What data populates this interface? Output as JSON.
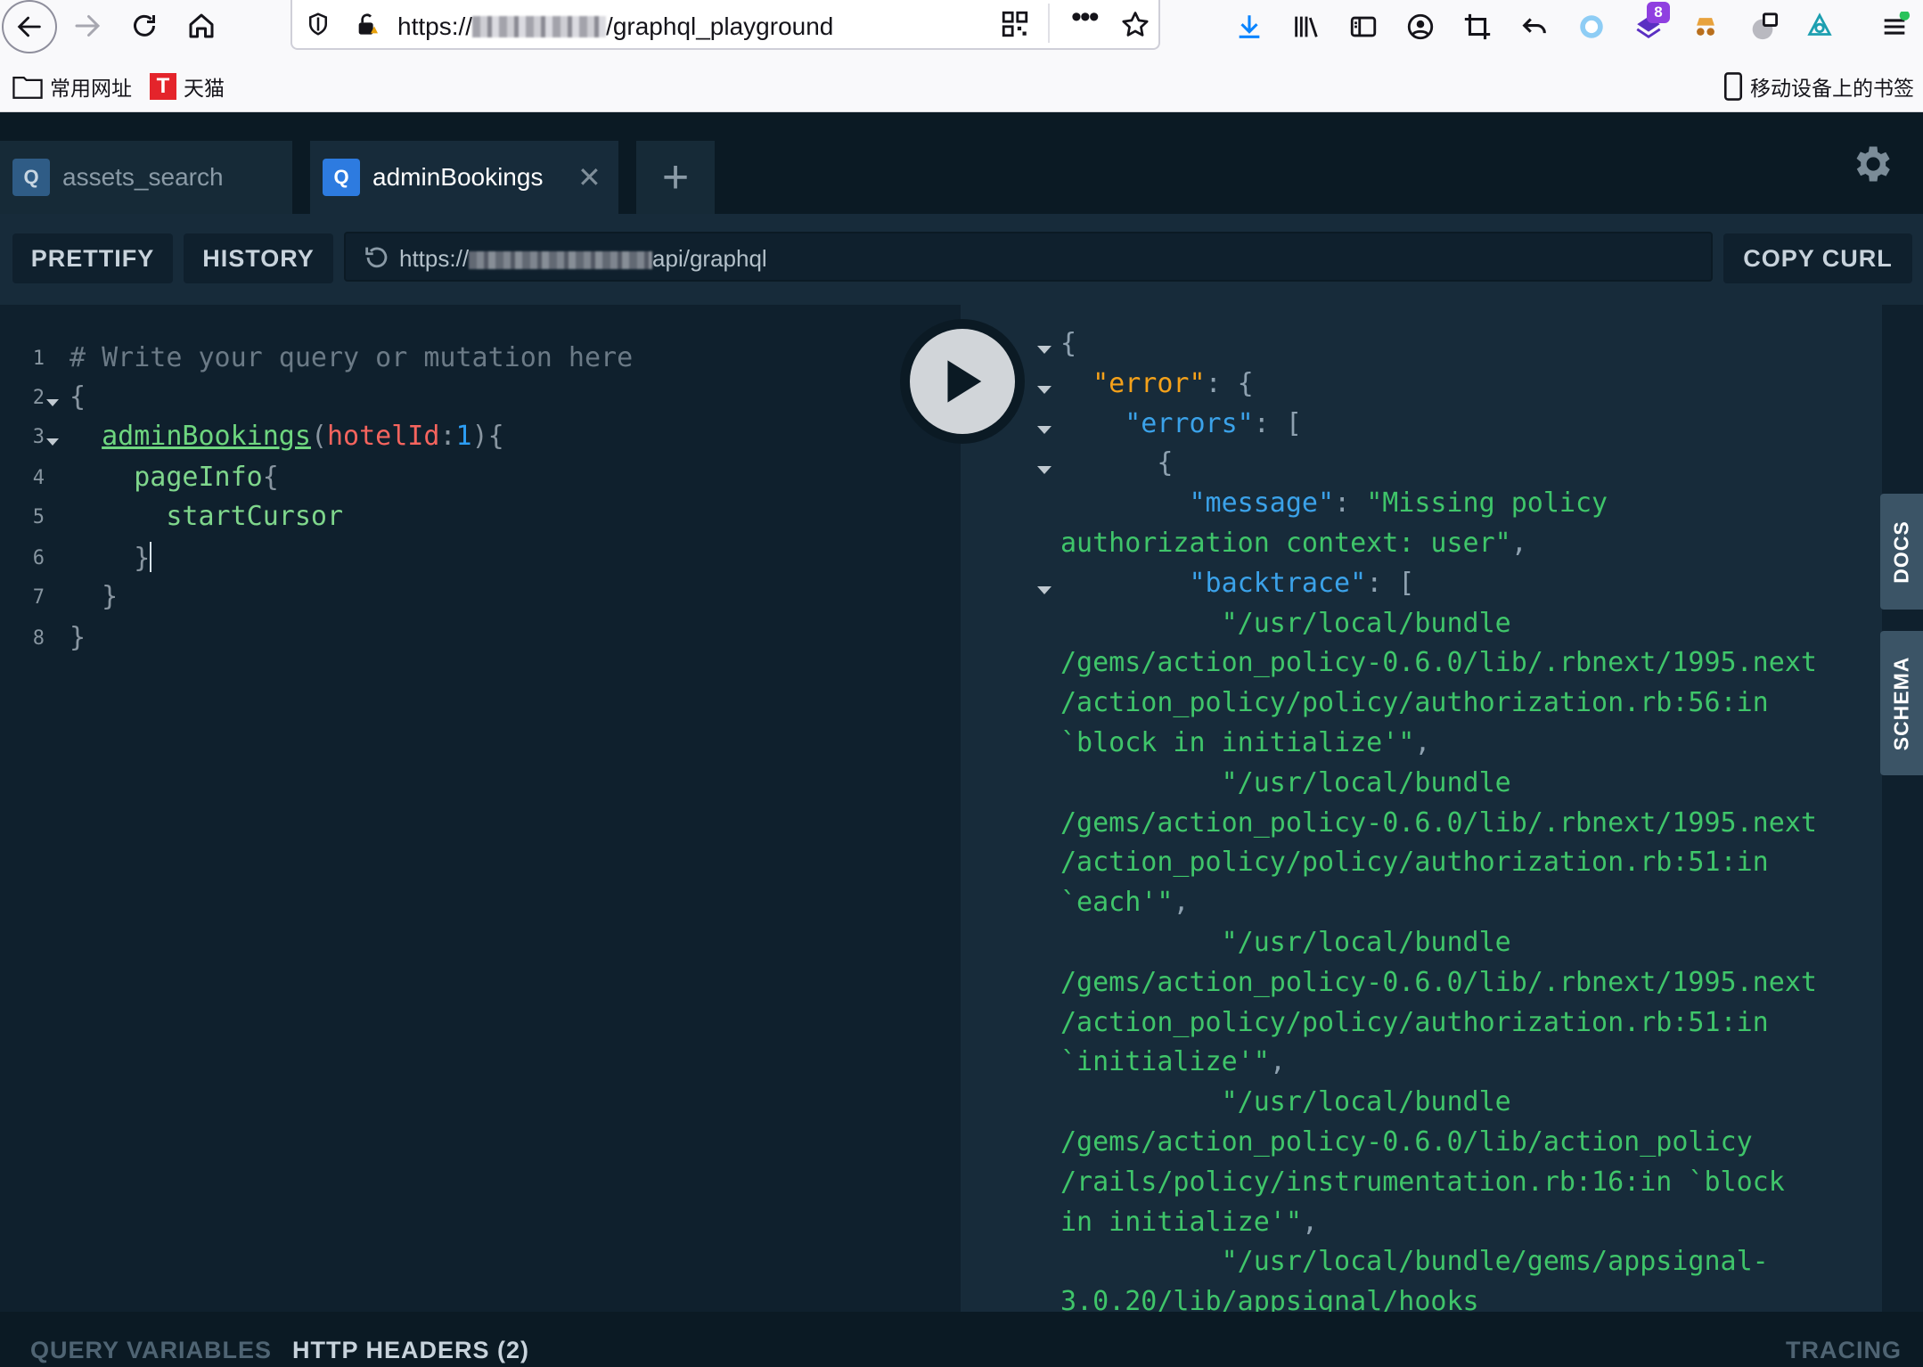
{
  "browser": {
    "url_prefix": "https://",
    "url_suffix": "/graphql_playground",
    "bookmarks": [
      {
        "label": "常用网址"
      },
      {
        "label": "天猫"
      }
    ],
    "mobile_bookmarks_label": "移动设备上的书签",
    "extension_badge": "8"
  },
  "playground": {
    "tabs": [
      {
        "badge": "Q",
        "label": "assets_search",
        "active": false
      },
      {
        "badge": "Q",
        "label": "adminBookings",
        "active": true
      }
    ],
    "close_glyph": "✕",
    "add_tab_glyph": "+",
    "toolbar": {
      "prettify_label": "PRETTIFY",
      "history_label": "HISTORY",
      "copy_curl_label": "COPY CURL",
      "endpoint_prefix": "https://",
      "endpoint_suffix": "api/graphql"
    },
    "editor": {
      "line_numbers": [
        "1",
        "2",
        "3",
        "4",
        "5",
        "6",
        "7",
        "8"
      ],
      "comment": "# Write your query or mutation here",
      "open_brace": "{",
      "field": "adminBookings",
      "paren_open": "(",
      "arg_name": "hotelId",
      "colon": ":",
      "arg_value": "1",
      "paren_close_brace": "){",
      "page_info": "pageInfo",
      "page_info_brace": "{",
      "start_cursor": "startCursor",
      "close_brace": "}"
    },
    "result": {
      "lines": [
        {
          "parts": [
            {
              "t": "{",
              "c": "j-brace"
            }
          ]
        },
        {
          "parts": [
            {
              "t": "  ",
              "c": ""
            },
            {
              "t": "\"error\"",
              "c": "j-key-err"
            },
            {
              "t": ": {",
              "c": "j-brace"
            }
          ]
        },
        {
          "parts": [
            {
              "t": "    ",
              "c": ""
            },
            {
              "t": "\"errors\"",
              "c": "j-key"
            },
            {
              "t": ": [",
              "c": "j-brace"
            }
          ]
        },
        {
          "parts": [
            {
              "t": "      {",
              "c": "j-brace"
            }
          ]
        },
        {
          "parts": [
            {
              "t": "        ",
              "c": ""
            },
            {
              "t": "\"message\"",
              "c": "j-key"
            },
            {
              "t": ": ",
              "c": "j-brace"
            },
            {
              "t": "\"Missing policy",
              "c": "j-str"
            }
          ]
        },
        {
          "parts": [
            {
              "t": "authorization context: user\"",
              "c": "j-str"
            },
            {
              "t": ",",
              "c": "j-brace"
            }
          ]
        },
        {
          "parts": [
            {
              "t": "        ",
              "c": ""
            },
            {
              "t": "\"backtrace\"",
              "c": "j-key"
            },
            {
              "t": ": [",
              "c": "j-brace"
            }
          ]
        },
        {
          "parts": [
            {
              "t": "          \"/usr/local/bundle",
              "c": "j-str"
            }
          ]
        },
        {
          "parts": [
            {
              "t": "/gems/action_policy-0.6.0/lib/.rbnext/1995.next",
              "c": "j-str"
            }
          ]
        },
        {
          "parts": [
            {
              "t": "/action_policy/policy/authorization.rb:56:in",
              "c": "j-str"
            }
          ]
        },
        {
          "parts": [
            {
              "t": "`block in initialize'\"",
              "c": "j-str"
            },
            {
              "t": ",",
              "c": "j-brace"
            }
          ]
        },
        {
          "parts": [
            {
              "t": "          \"/usr/local/bundle",
              "c": "j-str"
            }
          ]
        },
        {
          "parts": [
            {
              "t": "/gems/action_policy-0.6.0/lib/.rbnext/1995.next",
              "c": "j-str"
            }
          ]
        },
        {
          "parts": [
            {
              "t": "/action_policy/policy/authorization.rb:51:in",
              "c": "j-str"
            }
          ]
        },
        {
          "parts": [
            {
              "t": "`each'\"",
              "c": "j-str"
            },
            {
              "t": ",",
              "c": "j-brace"
            }
          ]
        },
        {
          "parts": [
            {
              "t": "          \"/usr/local/bundle",
              "c": "j-str"
            }
          ]
        },
        {
          "parts": [
            {
              "t": "/gems/action_policy-0.6.0/lib/.rbnext/1995.next",
              "c": "j-str"
            }
          ]
        },
        {
          "parts": [
            {
              "t": "/action_policy/policy/authorization.rb:51:in",
              "c": "j-str"
            }
          ]
        },
        {
          "parts": [
            {
              "t": "`initialize'\"",
              "c": "j-str"
            },
            {
              "t": ",",
              "c": "j-brace"
            }
          ]
        },
        {
          "parts": [
            {
              "t": "          \"/usr/local/bundle",
              "c": "j-str"
            }
          ]
        },
        {
          "parts": [
            {
              "t": "/gems/action_policy-0.6.0/lib/action_policy",
              "c": "j-str"
            }
          ]
        },
        {
          "parts": [
            {
              "t": "/rails/policy/instrumentation.rb:16:in `block",
              "c": "j-str"
            }
          ]
        },
        {
          "parts": [
            {
              "t": "in initialize'\"",
              "c": "j-str"
            },
            {
              "t": ",",
              "c": "j-brace"
            }
          ]
        },
        {
          "parts": [
            {
              "t": "          \"/usr/local/bundle/gems/appsignal-",
              "c": "j-str"
            }
          ]
        },
        {
          "parts": [
            {
              "t": "3.0.20/lib/appsignal/hooks",
              "c": "j-str"
            }
          ]
        }
      ]
    },
    "side_tabs": {
      "docs": "DOCS",
      "schema": "SCHEMA"
    },
    "bottom": {
      "query_variables": "QUERY VARIABLES",
      "http_headers": "HTTP HEADERS (2)",
      "tracing": "TRACING"
    }
  },
  "colors": {
    "accent": "#2d7be0",
    "json_key": "#3ba2e9",
    "json_string": "#3fc56a",
    "json_error_key": "#f4a11a"
  }
}
